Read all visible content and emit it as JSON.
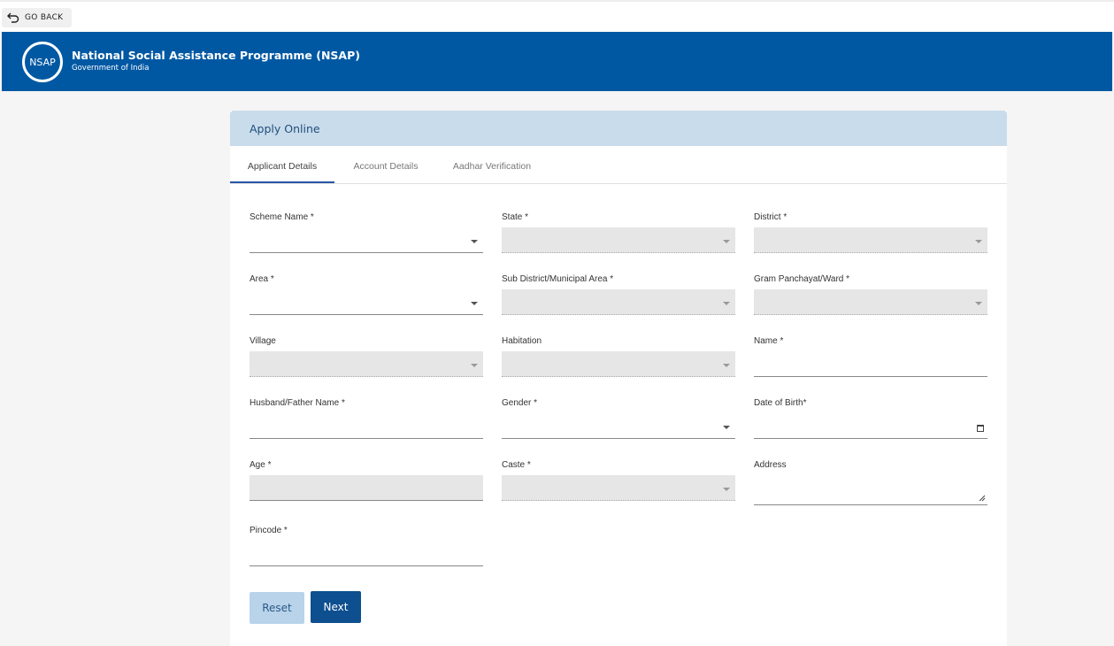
{
  "topbar": {
    "go_back_label": "GO BACK"
  },
  "header": {
    "logo_text": "NSAP",
    "title": "National Social Assistance Programme (NSAP)",
    "subtitle": "Government of India",
    "color": "#0058a3"
  },
  "card": {
    "title": "Apply Online",
    "tabs": [
      {
        "label": "Applicant Details",
        "active": true
      },
      {
        "label": "Account Details",
        "active": false
      },
      {
        "label": "Aadhar Verification",
        "active": false
      }
    ]
  },
  "form": {
    "scheme_name": {
      "label": "Scheme Name *",
      "value": ""
    },
    "state": {
      "label": "State *",
      "value": ""
    },
    "district": {
      "label": "District *",
      "value": ""
    },
    "area": {
      "label": "Area *",
      "value": ""
    },
    "sub_district": {
      "label": "Sub District/Municipal Area *",
      "value": ""
    },
    "gram_panchayat": {
      "label": "Gram Panchayat/Ward *",
      "value": ""
    },
    "village": {
      "label": "Village",
      "value": ""
    },
    "habitation": {
      "label": "Habitation",
      "value": ""
    },
    "name": {
      "label": "Name *",
      "value": ""
    },
    "husband_father_name": {
      "label": "Husband/Father Name *",
      "value": ""
    },
    "gender": {
      "label": "Gender *",
      "value": ""
    },
    "dob": {
      "label": "Date of Birth*",
      "value": ""
    },
    "age": {
      "label": "Age *",
      "value": ""
    },
    "caste": {
      "label": "Caste *",
      "value": ""
    },
    "address": {
      "label": "Address",
      "value": ""
    },
    "pincode": {
      "label": "Pincode *",
      "value": ""
    }
  },
  "buttons": {
    "reset_label": "Reset",
    "next_label": "Next"
  }
}
